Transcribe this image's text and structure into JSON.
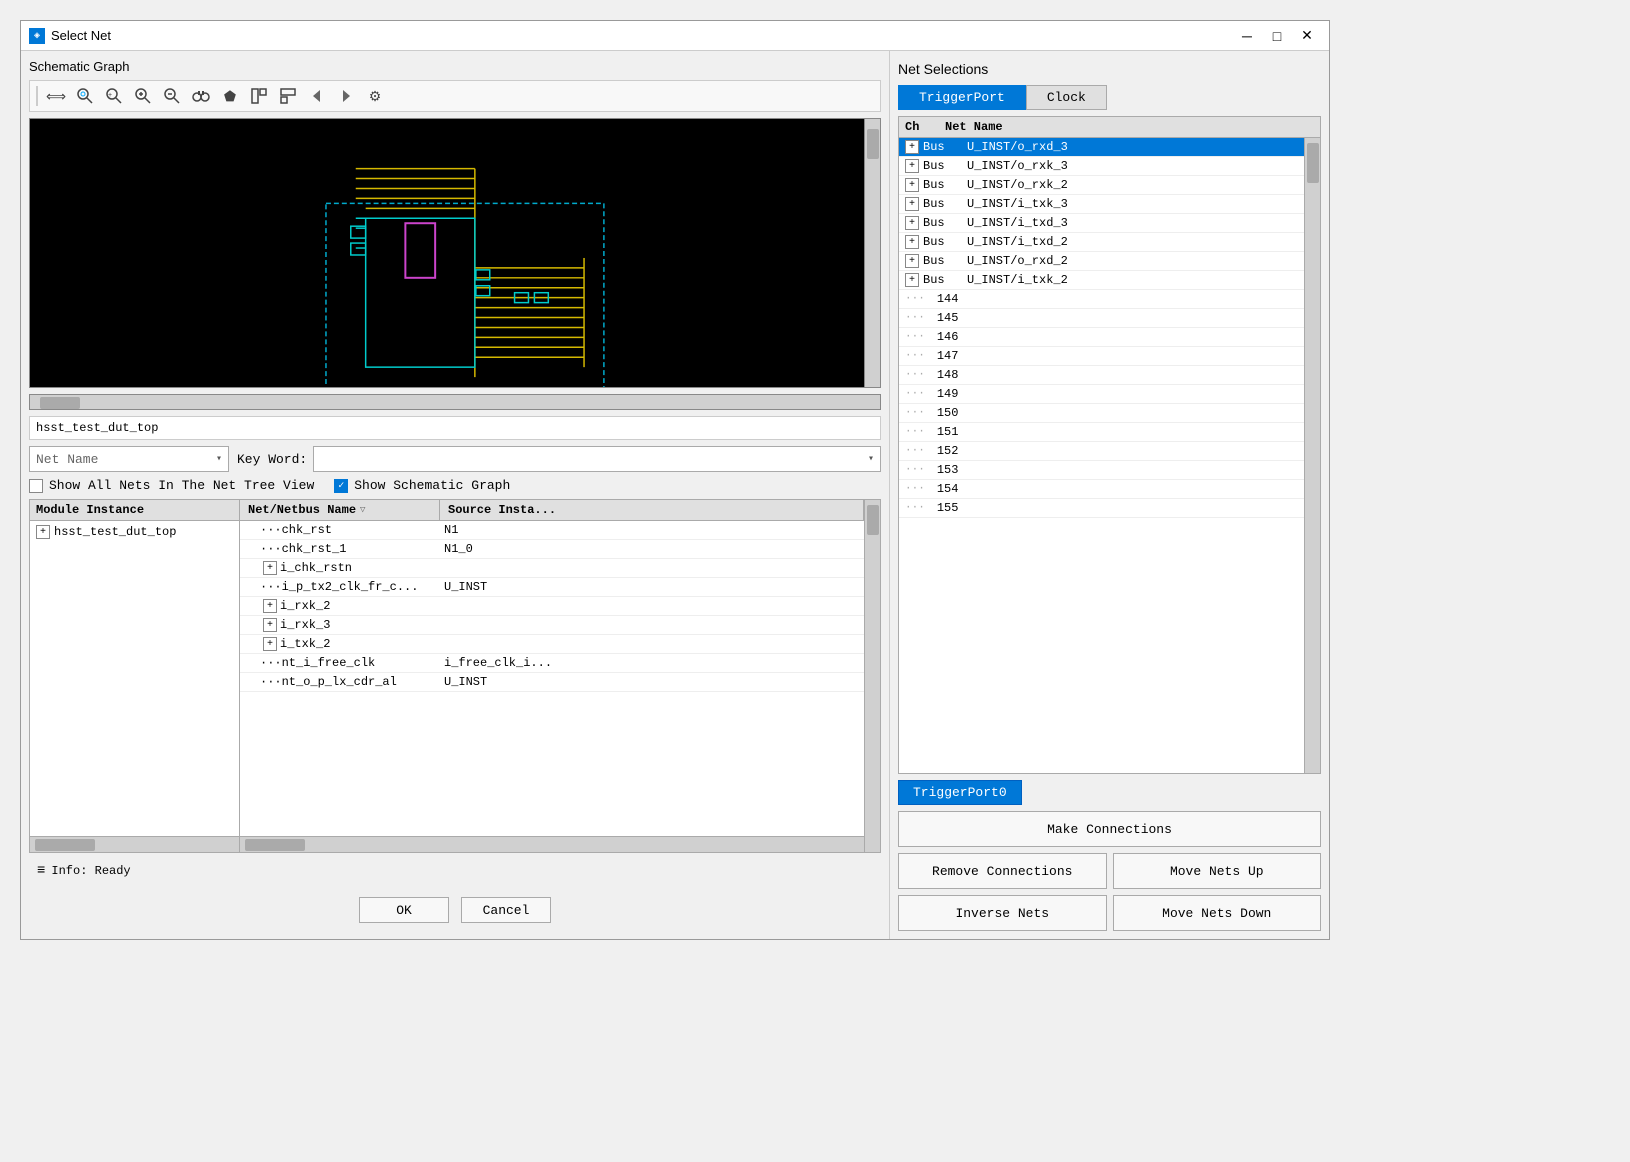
{
  "window": {
    "title": "Select Net",
    "icon": "◈"
  },
  "left": {
    "schematic_title": "Schematic Graph",
    "breadcrumb": "hsst_test_dut_top",
    "filter": {
      "net_name_label": "Net Name",
      "keyword_label": "Key Word:",
      "keyword_placeholder": ""
    },
    "checkboxes": {
      "show_all_nets": "Show All Nets In The Net Tree View",
      "show_schematic": "Show Schematic Graph",
      "show_all_checked": false,
      "show_schematic_checked": true
    },
    "module_header": "Module Instance",
    "module_items": [
      {
        "label": "hsst_test_dut_top",
        "expanded": false
      }
    ],
    "net_headers": [
      "Net/Netbus Name",
      "Source Insta..."
    ],
    "net_rows": [
      {
        "indent": 1,
        "name": "chk_rst",
        "src": "N1",
        "has_expand": false
      },
      {
        "indent": 1,
        "name": "chk_rst_1",
        "src": "N1_0",
        "has_expand": false
      },
      {
        "indent": 1,
        "name": "i_chk_rstn",
        "src": "",
        "has_expand": true
      },
      {
        "indent": 1,
        "name": "i_p_tx2_clk_fr_c...",
        "src": "U_INST",
        "has_expand": false
      },
      {
        "indent": 1,
        "name": "i_rxk_2",
        "src": "",
        "has_expand": true
      },
      {
        "indent": 1,
        "name": "i_rxk_3",
        "src": "",
        "has_expand": true
      },
      {
        "indent": 1,
        "name": "i_txk_2",
        "src": "",
        "has_expand": true
      },
      {
        "indent": 1,
        "name": "nt_i_free_clk",
        "src": "i_free_clk_i...",
        "has_expand": false
      },
      {
        "indent": 1,
        "name": "nt_o_p_lx_cdr_al",
        "src": "U_INST",
        "has_expand": false
      }
    ],
    "info": "Info: Ready"
  },
  "right": {
    "title": "Net Selections",
    "tabs": [
      {
        "label": "TriggerPort",
        "active": true
      },
      {
        "label": "Clock",
        "active": false
      }
    ],
    "table_headers": {
      "ch": "Ch",
      "net_name": "Net Name"
    },
    "rows": [
      {
        "expand": true,
        "type": "Bus",
        "name": "U_INST/o_rxd_3",
        "selected": true
      },
      {
        "expand": true,
        "type": "Bus",
        "name": "U_INST/o_rxk_3",
        "selected": false
      },
      {
        "expand": true,
        "type": "Bus",
        "name": "U_INST/o_rxk_2",
        "selected": false
      },
      {
        "expand": true,
        "type": "Bus",
        "name": "U_INST/i_txk_3",
        "selected": false
      },
      {
        "expand": true,
        "type": "Bus",
        "name": "U_INST/i_txd_3",
        "selected": false
      },
      {
        "expand": true,
        "type": "Bus",
        "name": "U_INST/i_txd_2",
        "selected": false
      },
      {
        "expand": true,
        "type": "Bus",
        "name": "U_INST/o_rxd_2",
        "selected": false
      },
      {
        "expand": true,
        "type": "Bus",
        "name": "U_INST/i_txk_2",
        "selected": false
      }
    ],
    "numbered_rows": [
      "144",
      "145",
      "146",
      "147",
      "148",
      "149",
      "150",
      "151",
      "152",
      "153",
      "154",
      "155"
    ],
    "trigger_port_label": "TriggerPort0",
    "buttons": {
      "make_connections": "Make Connections",
      "remove_connections": "Remove Connections",
      "move_nets_up": "Move Nets Up",
      "inverse_nets": "Inverse Nets",
      "move_nets_down": "Move Nets Down"
    }
  },
  "footer": {
    "ok": "OK",
    "cancel": "Cancel"
  },
  "toolbar": {
    "icons": [
      "⟺",
      "🔍",
      "🔍",
      "⊕",
      "⊖",
      "🔭",
      "⬟",
      "⬡",
      "⬢",
      "←",
      "→",
      "⚙"
    ]
  }
}
